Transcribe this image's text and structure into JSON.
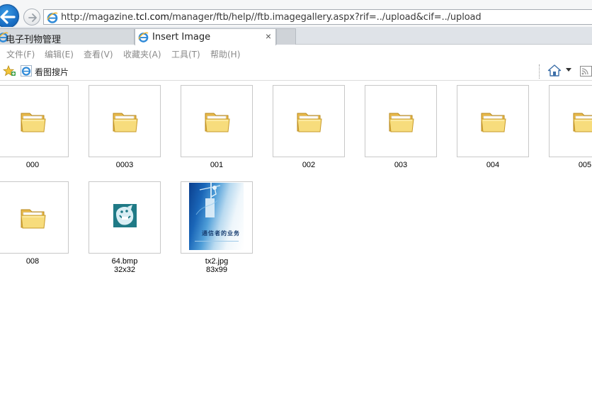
{
  "browser": {
    "url_prefix": "http://magazine.",
    "url_host": "tcl.com",
    "url_suffix": "/manager/ftb/help//ftb.imagegallery.aspx?rif=../upload&cif=../upload",
    "tabs": [
      {
        "label": "电子刊物管理",
        "active": false
      },
      {
        "label": "Insert Image",
        "active": true,
        "close": "×"
      }
    ],
    "menu": [
      "文件(F)",
      "编辑(E)",
      "查看(V)",
      "收藏夹(A)",
      "工具(T)",
      "帮助(H)"
    ],
    "favorites": {
      "link_label": "看图搜片"
    }
  },
  "gallery": {
    "folders": [
      "000",
      "0003",
      "001",
      "002",
      "003",
      "004",
      "005",
      "008"
    ],
    "images": [
      {
        "name": "64.bmp",
        "dimensions": "32x32"
      },
      {
        "name": "tx2.jpg",
        "dimensions": "83x99"
      }
    ]
  },
  "colors": {
    "back_button": "#1a6fc5",
    "folder": "#f5d36b",
    "menu_text": "#8a8a8a"
  }
}
